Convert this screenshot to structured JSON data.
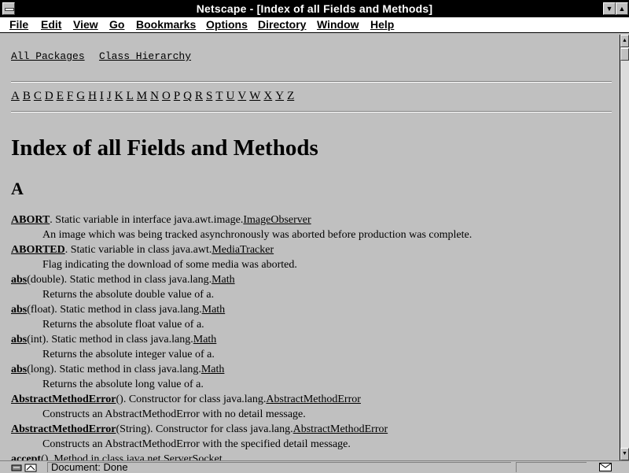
{
  "window": {
    "title": "Netscape - [Index of all Fields and Methods]"
  },
  "menu": [
    "File",
    "Edit",
    "View",
    "Go",
    "Bookmarks",
    "Options",
    "Directory",
    "Window",
    "Help"
  ],
  "nav": {
    "all_packages": "All Packages",
    "class_hierarchy": "Class Hierarchy"
  },
  "alphabet": [
    "A",
    "B",
    "C",
    "D",
    "E",
    "F",
    "G",
    "H",
    "I",
    "J",
    "K",
    "L",
    "M",
    "N",
    "O",
    "P",
    "Q",
    "R",
    "S",
    "T",
    "U",
    "V",
    "W",
    "X",
    "Y",
    "Z"
  ],
  "page": {
    "title": "Index of all Fields and Methods",
    "section": "A"
  },
  "entries": [
    {
      "name": "ABORT",
      "rest": ". Static variable in interface java.awt.image.",
      "cls": "ImageObserver",
      "desc": "An image which was being tracked asynchronously was aborted before production was complete."
    },
    {
      "name": "ABORTED",
      "rest": ". Static variable in class java.awt.",
      "cls": "MediaTracker",
      "desc": "Flag indicating the download of some media was aborted."
    },
    {
      "name": "abs",
      "rest": "(double). Static method in class java.lang.",
      "cls": "Math",
      "desc": "Returns the absolute double value of a."
    },
    {
      "name": "abs",
      "rest": "(float). Static method in class java.lang.",
      "cls": "Math",
      "desc": "Returns the absolute float value of a."
    },
    {
      "name": "abs",
      "rest": "(int). Static method in class java.lang.",
      "cls": "Math",
      "desc": "Returns the absolute integer value of a."
    },
    {
      "name": "abs",
      "rest": "(long). Static method in class java.lang.",
      "cls": "Math",
      "desc": "Returns the absolute long value of a."
    },
    {
      "name": "AbstractMethodError",
      "rest": "(). Constructor for class java.lang.",
      "cls": "AbstractMethodError",
      "desc": "Constructs an AbstractMethodError with no detail message."
    },
    {
      "name": "AbstractMethodError",
      "rest": "(String). Constructor for class java.lang.",
      "cls": "AbstractMethodError",
      "desc": "Constructs an AbstractMethodError with the specified detail message."
    },
    {
      "name": "accept",
      "rest": "(). Method in class java.net.",
      "cls": "ServerSocket",
      "desc": ""
    }
  ],
  "status": {
    "text": "Document: Done"
  },
  "colors": {
    "titlebar": "#000000",
    "background": "#c0c0c0",
    "menubar": "#ffffff"
  }
}
